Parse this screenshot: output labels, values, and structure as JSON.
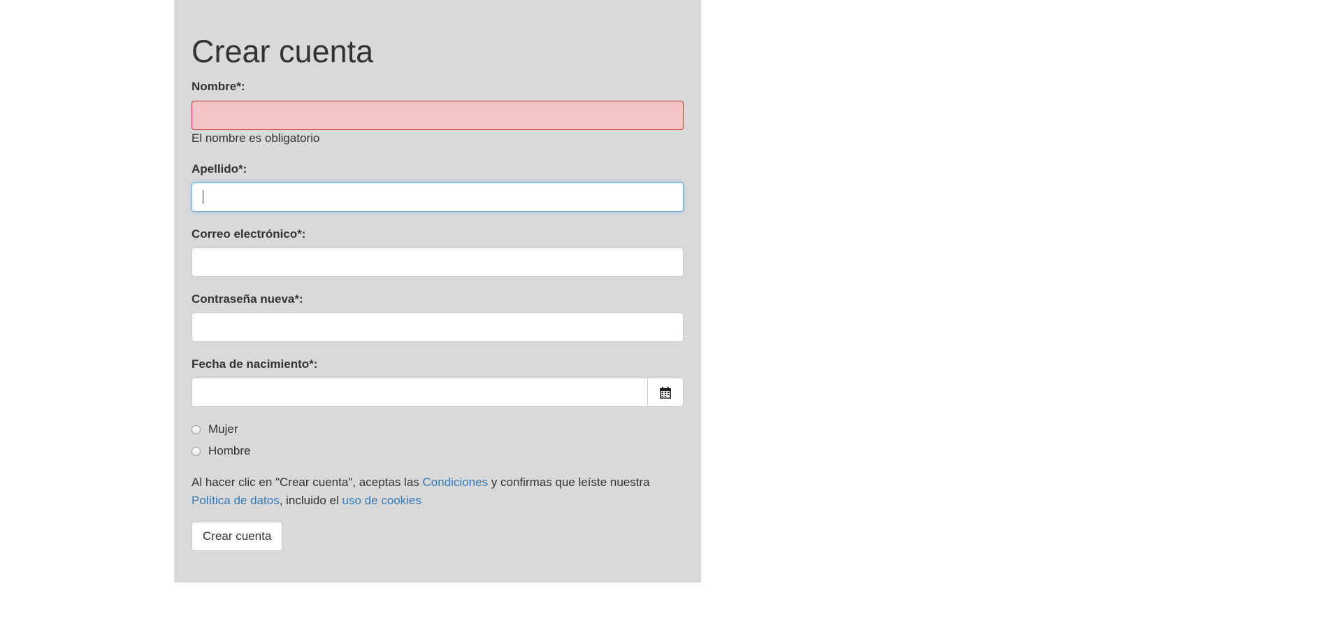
{
  "form": {
    "title": "Crear cuenta",
    "nombre": {
      "label": "Nombre*:",
      "value": "",
      "error": "El nombre es obligatorio"
    },
    "apellido": {
      "label": "Apellido*:",
      "value": ""
    },
    "correo": {
      "label": "Correo electrónico*:",
      "value": ""
    },
    "contrasena": {
      "label": "Contraseña nueva*:",
      "value": ""
    },
    "fecha": {
      "label": "Fecha de nacimiento*:",
      "value": "",
      "icon": "calendar-icon"
    },
    "gender_options": [
      {
        "label": "Mujer",
        "checked": false
      },
      {
        "label": "Hombre",
        "checked": false
      }
    ],
    "terms": {
      "text_1": "Al hacer clic en \"Crear cuenta\", aceptas las ",
      "link_conditions": "Condiciones",
      "text_2": " y confirmas que leíste nuestra ",
      "link_data_policy": "Política de datos",
      "text_3": ", incluido el ",
      "link_cookies": "uso de cookies"
    },
    "submit_label": "Crear cuenta"
  },
  "colors": {
    "panel_background": "#d9d9d9",
    "error_background": "#f4c4c4",
    "error_border": "#cc3333",
    "link": "#337ab7",
    "focus_border": "#66afe9"
  }
}
